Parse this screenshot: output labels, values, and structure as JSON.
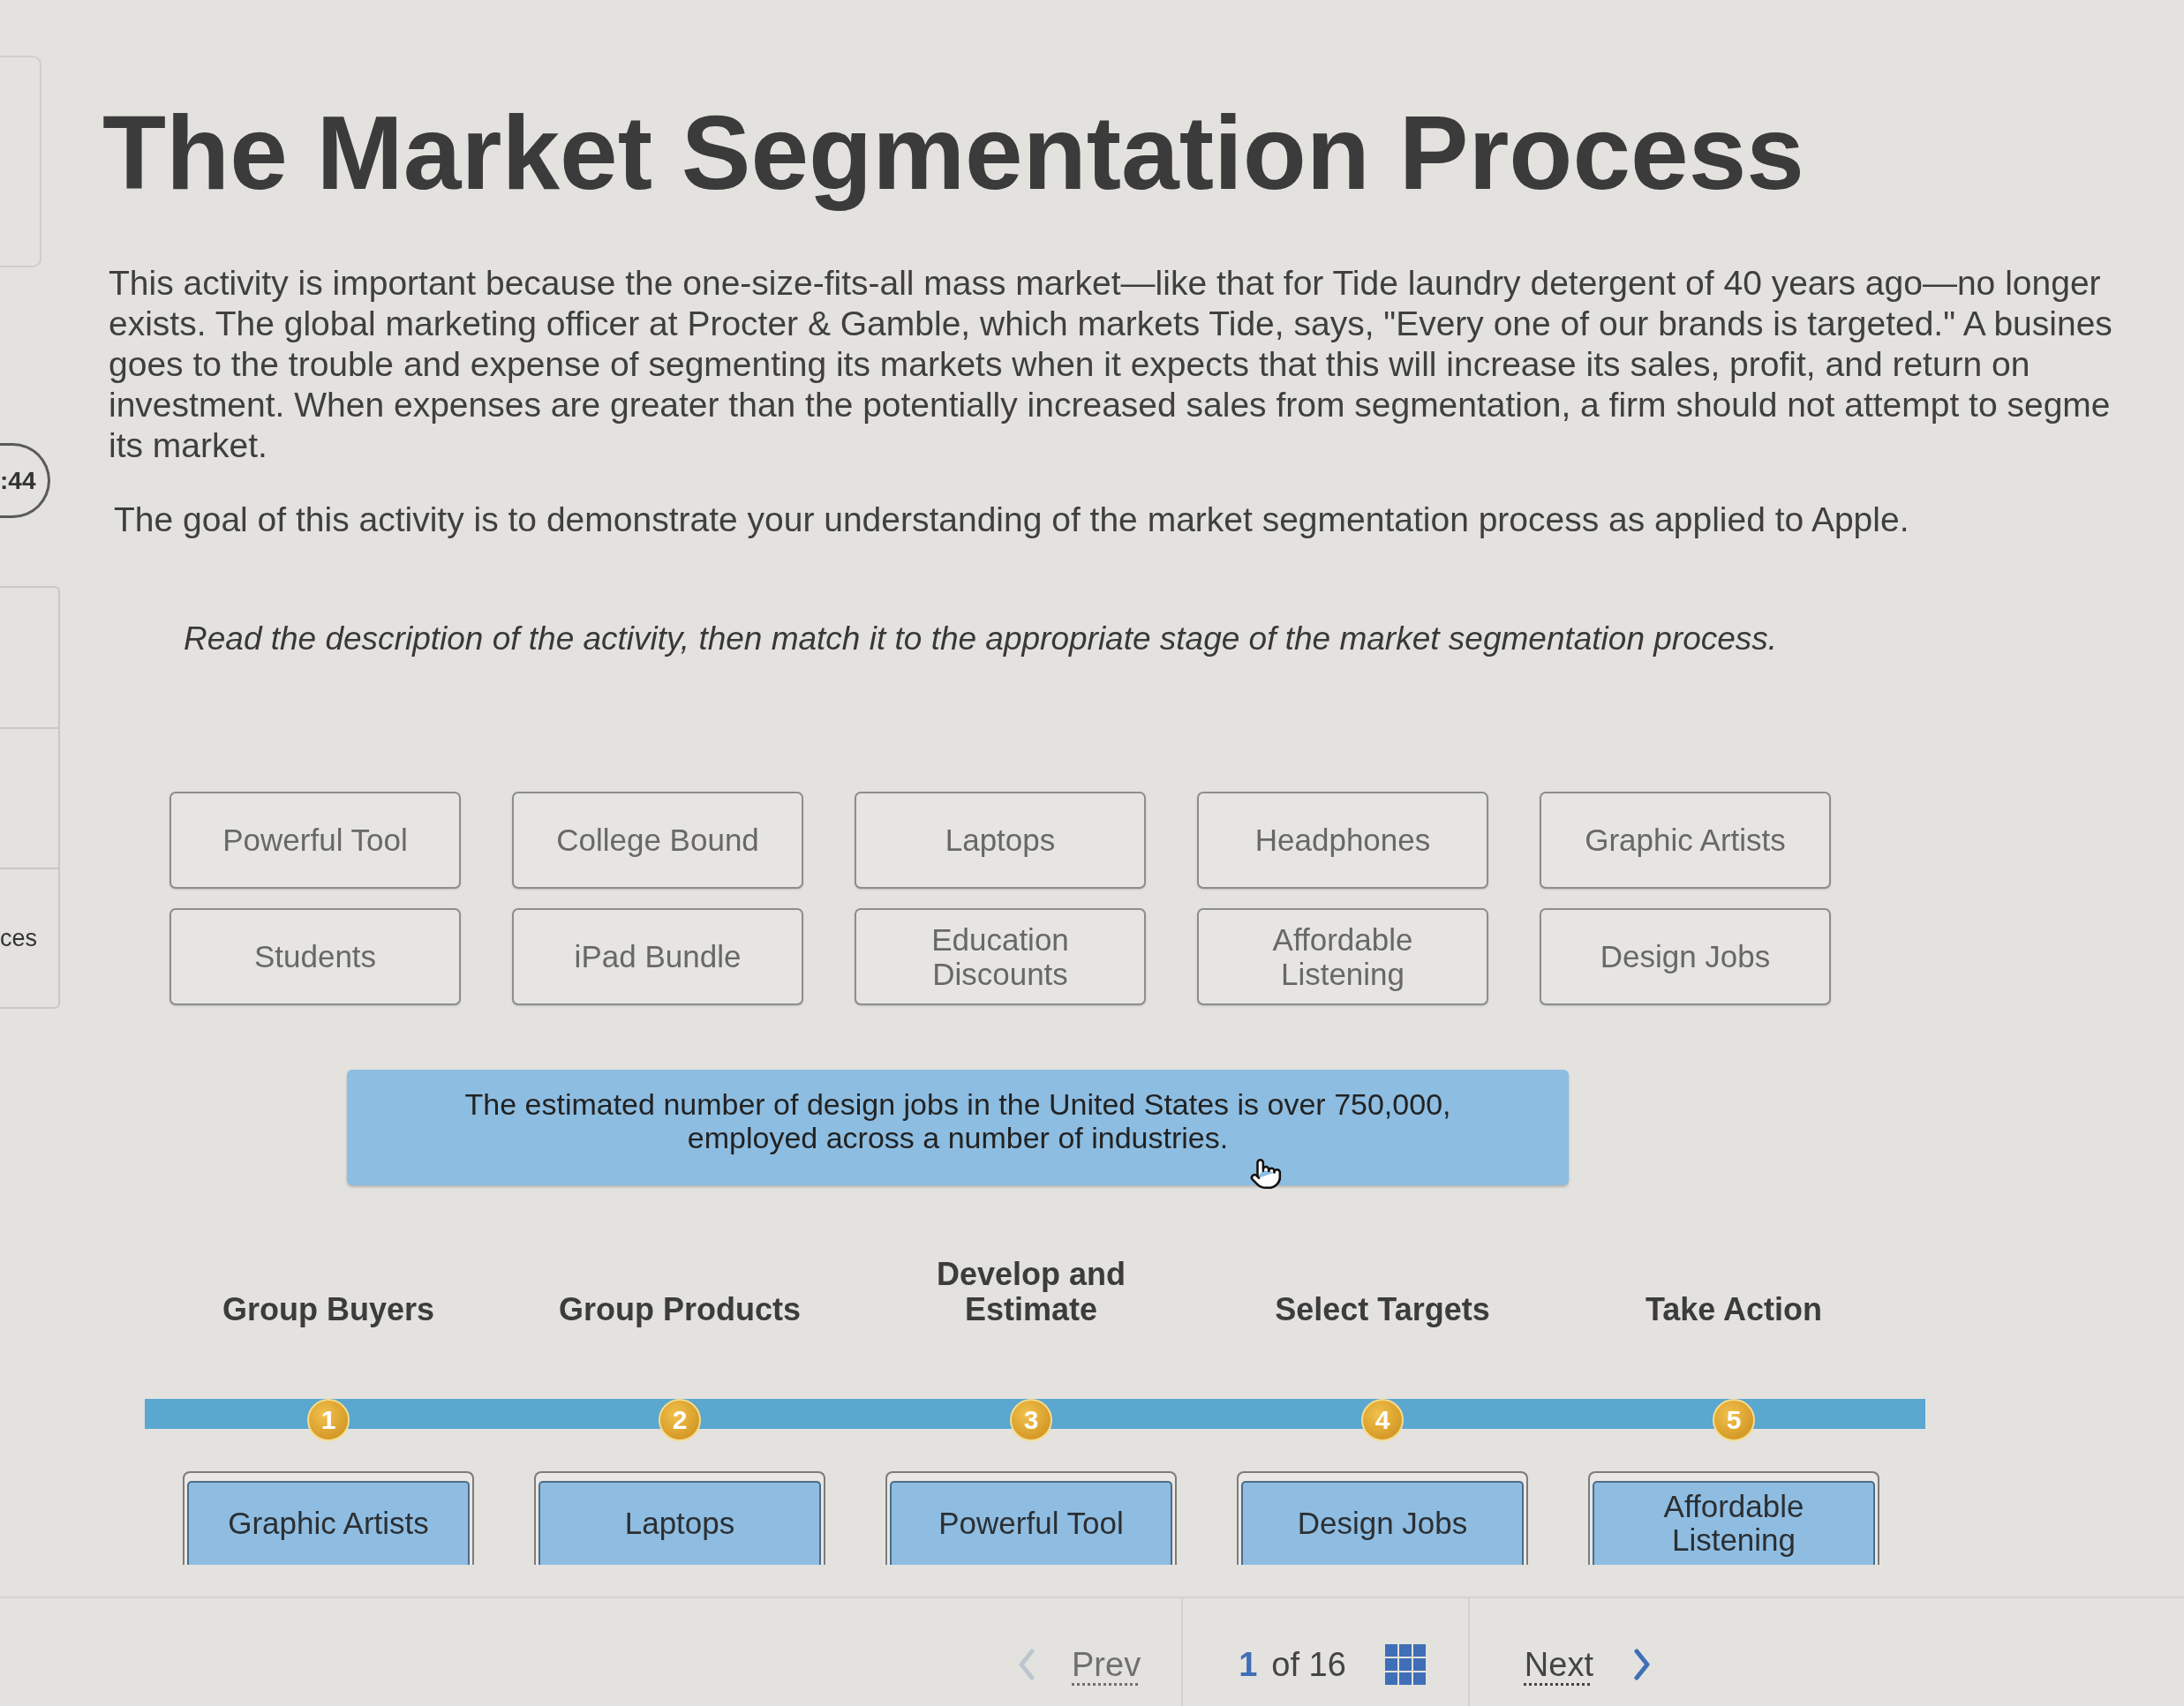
{
  "side_panel": {
    "timer": ":44",
    "label": "ces"
  },
  "title": "The Market Segmentation Process",
  "intro": {
    "lines": [
      "This activity is important because the one-size-fits-all mass market—like that for Tide laundry detergent of 40 years ago—no longer",
      "exists. The global marketing officer at Procter & Gamble, which markets Tide, says, \"Every one of our brands is targeted.\" A busines",
      "goes to the trouble and expense of segmenting its markets when it expects that this will increase its sales, profit, and return on",
      "investment. When expenses are greater than the potentially increased sales from segmentation, a firm should not attempt to segme",
      "its market."
    ]
  },
  "goal": "The goal of this activity is to demonstrate your understanding of the market segmentation process as applied to Apple.",
  "instruction": "Read the description of the activity, then match it to the appropriate stage of the market segmentation process.",
  "cards": [
    {
      "label": "Powerful Tool"
    },
    {
      "label": "College Bound"
    },
    {
      "label": "Laptops"
    },
    {
      "label": "Headphones"
    },
    {
      "label": "Graphic Artists"
    },
    {
      "label": "Students"
    },
    {
      "label": "iPad Bundle"
    },
    {
      "label": "Education Discounts"
    },
    {
      "label": "Affordable Listening"
    },
    {
      "label": "Design Jobs"
    }
  ],
  "prompt": {
    "lines": [
      "The estimated number of design jobs in the United States is over 750,000,",
      "employed across a number of industries."
    ]
  },
  "stages": [
    {
      "label": "Group Buyers",
      "number": "1",
      "answer": "Graphic Artists"
    },
    {
      "label": "Group Products",
      "number": "2",
      "answer": "Laptops"
    },
    {
      "label": "Develop and Estimate",
      "number": "3",
      "answer": "Powerful Tool"
    },
    {
      "label": "Select Targets",
      "number": "4",
      "answer": "Design Jobs"
    },
    {
      "label": "Take Action",
      "number": "5",
      "answer": "Affordable Listening"
    }
  ],
  "pager": {
    "prev": {
      "label": "Prev",
      "disabled": true
    },
    "current": "1",
    "total": "of 16",
    "next": {
      "label": "Next",
      "disabled": false
    }
  }
}
